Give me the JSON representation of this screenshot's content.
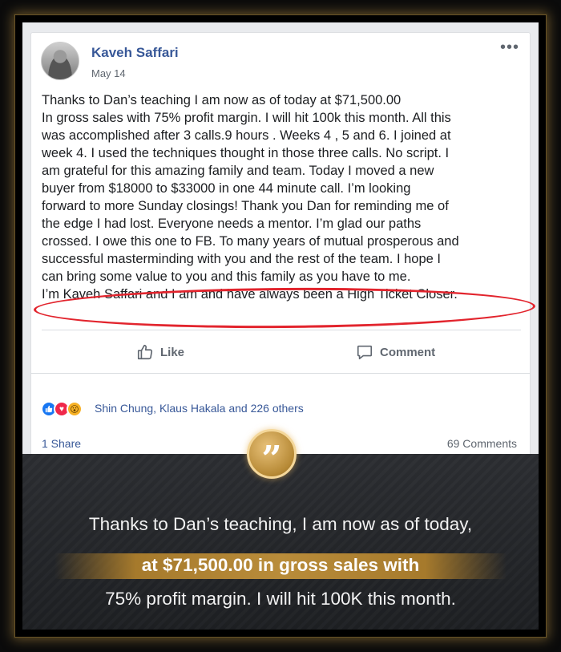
{
  "post": {
    "author": "Kaveh Saffari",
    "date": "May 14",
    "text_lines": [
      "Thanks to Dan’s teaching I am now as of today at $71,500.00",
      "In gross sales with 75% profit margin. I will hit 100k this month. All this",
      "was accomplished after 3 calls.9 hours . Weeks 4 , 5 and 6. I joined at",
      "week 4. I used the techniques thought in those three calls. No script. I",
      "am grateful for this amazing family and team. Today I moved a new",
      "buyer from $18000 to $33000 in one 44 minute call. I’m looking",
      "forward to more Sunday closings! Thank you Dan for reminding me of",
      "the edge I had lost. Everyone needs a mentor. I’m glad our paths",
      "crossed. I owe this one to FB. To many years of mutual prosperous and",
      "successful masterminding with you and the rest of the team. I hope I",
      "can bring some value to you and this family as you have to me.",
      "I’m Kaveh Saffari and I am and have always been a High Ticket Closer."
    ],
    "more_icon": "•••"
  },
  "actions": {
    "like_label": "Like",
    "comment_label": "Comment"
  },
  "reactions": {
    "icons": [
      "like-icon",
      "love-icon",
      "wow-icon"
    ],
    "summary": "Shin Chung, Klaus Hakala and 226 others",
    "shares": "1 Share",
    "comments": "69 Comments"
  },
  "banner": {
    "quote_mark": "”",
    "line1": "Thanks to Dan’s teaching, I am now as of today,",
    "line2": "at $71,500.00 in gross sales with",
    "line3": "75% profit margin. I will hit 100K this month."
  },
  "colors": {
    "link_blue": "#385898",
    "highlight_red": "#e2242d",
    "gold": "#b98c3a"
  }
}
